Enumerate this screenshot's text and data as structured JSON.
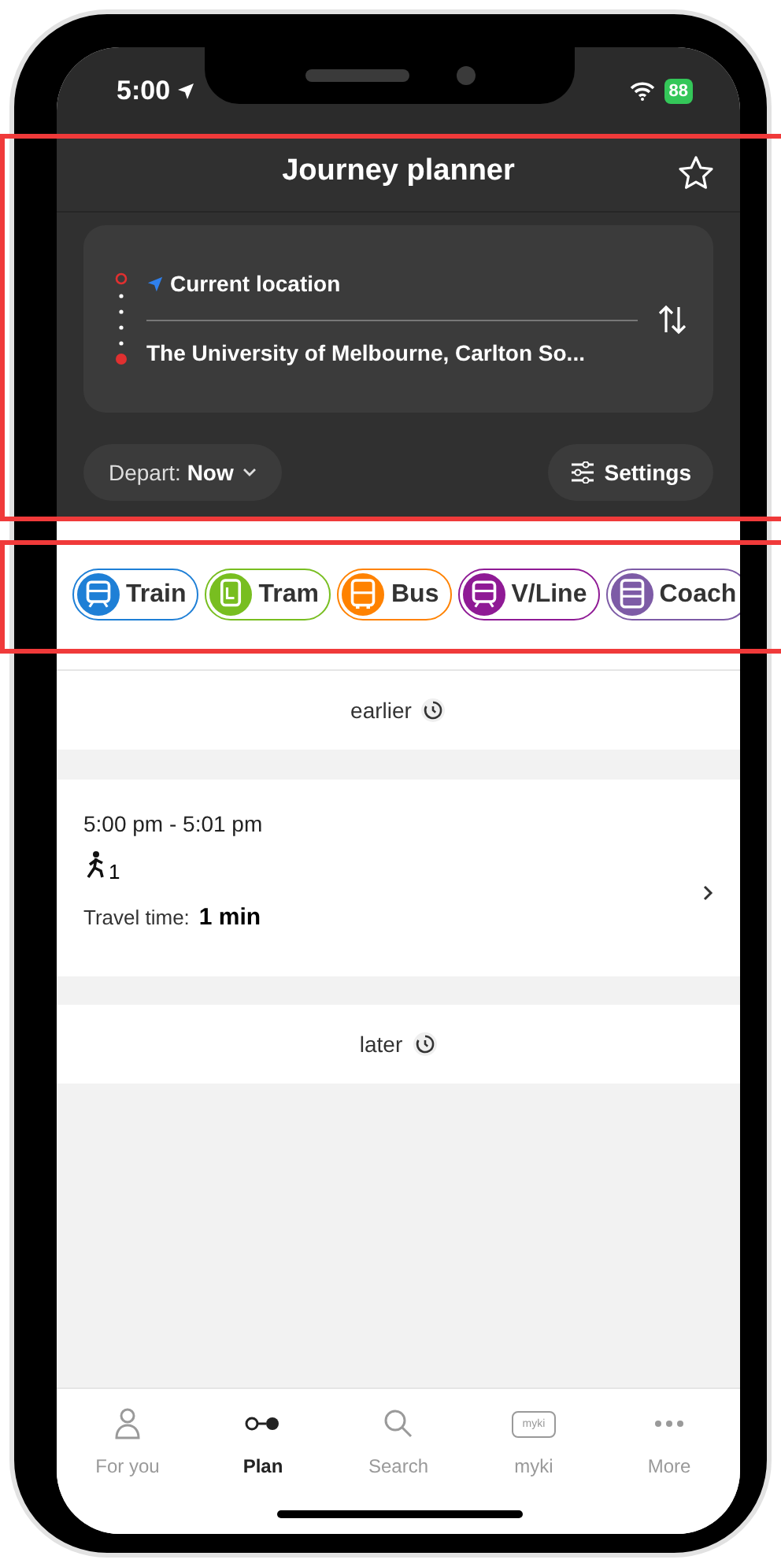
{
  "status_bar": {
    "time": "5:00",
    "battery": "88"
  },
  "header": {
    "title": "Journey planner",
    "favorite": false
  },
  "route": {
    "from": "Current location",
    "to": "The University of Melbourne, Carlton So..."
  },
  "depart": {
    "label": "Depart:",
    "value": "Now"
  },
  "settings": {
    "label": "Settings"
  },
  "modes": [
    {
      "kind": "train",
      "label": "Train",
      "color": "#1e7fd6"
    },
    {
      "kind": "tram",
      "label": "Tram",
      "color": "#78be20"
    },
    {
      "kind": "bus",
      "label": "Bus",
      "color": "#ff8200"
    },
    {
      "kind": "vline",
      "label": "V/Line",
      "color": "#8f1a95"
    },
    {
      "kind": "coach",
      "label": "Coach",
      "color": "#7d5ba6"
    }
  ],
  "earlier": {
    "label": "earlier"
  },
  "journey": {
    "times": "5:00 pm - 5:01 pm",
    "walk_legs": "1",
    "travel_label": "Travel time:",
    "travel_time": "1 min"
  },
  "later": {
    "label": "later"
  },
  "tabs": [
    {
      "kind": "person",
      "label": "For you",
      "selected": false
    },
    {
      "kind": "plan",
      "label": "Plan",
      "selected": true
    },
    {
      "kind": "search",
      "label": "Search",
      "selected": false
    },
    {
      "kind": "card",
      "label": "myki",
      "icon_text": "myki",
      "selected": false
    },
    {
      "kind": "more",
      "label": "More",
      "selected": false
    }
  ]
}
